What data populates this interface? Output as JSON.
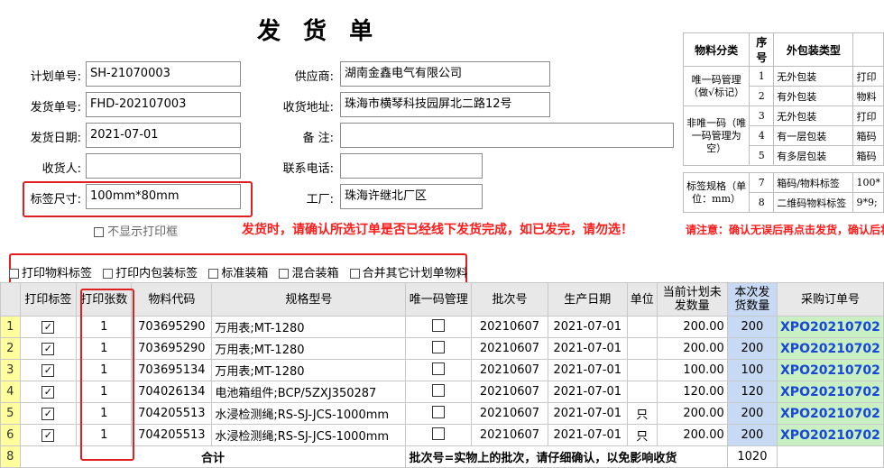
{
  "form": {
    "title": "发 货 单",
    "fields": {
      "plan_no": {
        "label": "计划单号:",
        "value": "SH-21070003"
      },
      "ship_no": {
        "label": "发货单号:",
        "value": "FHD-202107003"
      },
      "ship_date": {
        "label": "发货日期:",
        "value": "2021-07-01"
      },
      "receiver": {
        "label": "收货人:",
        "value": ""
      },
      "label_size": {
        "label": "标签尺寸:",
        "value": "100mm*80mm"
      },
      "supplier": {
        "label": "供应商:",
        "value": "湖南金鑫电气有限公司"
      },
      "ship_address": {
        "label": "收货地址:",
        "value": "珠海市横琴科技园屏北二路12号"
      },
      "remark": {
        "label": "备  注:",
        "value": ""
      },
      "phone": {
        "label": "联系电话:",
        "value": ""
      },
      "factory": {
        "label": "工厂:",
        "value": "珠海许继北厂区"
      }
    },
    "no_print_box_label": "不显示打印框",
    "warning_main": "发货时，请确认所选订单是否已经线下发货完成，如已发完，请勿选！",
    "warning_side": "请注意：确认无误后再点击发货，确认后将"
  },
  "options": [
    "打印物料标签",
    "打印内包装标签",
    "标准装箱",
    "混合装箱",
    "合并其它计划单物料"
  ],
  "packaging": {
    "headers": [
      "物料分类",
      "序号",
      "外包装类型",
      ""
    ],
    "groups": [
      {
        "category": "唯一码管理（做√标记）",
        "rows": [
          {
            "no": "1",
            "type": "无外包装",
            "extra": "打印"
          },
          {
            "no": "2",
            "type": "有外包装",
            "extra": "物料"
          }
        ]
      },
      {
        "category": "非唯一码（唯一码管理为空）",
        "rows": [
          {
            "no": "3",
            "type": "无外包装",
            "extra": "打印"
          },
          {
            "no": "4",
            "type": "有一层包装",
            "extra": "箱码"
          },
          {
            "no": "5",
            "type": "有多层包装",
            "extra": "箱码"
          }
        ]
      },
      {
        "category": "标签规格（单位：mm）",
        "rows": [
          {
            "no": "7",
            "type": "箱码/物料标签",
            "extra": "100*"
          },
          {
            "no": "8",
            "type": "二维码物料标签",
            "extra": "9*9;"
          }
        ]
      }
    ]
  },
  "grid": {
    "headers": [
      "",
      "打印标签",
      "打印张数",
      "物料代码",
      "规格型号",
      "唯一码管理",
      "批次号",
      "生产日期",
      "单位",
      "当前计划未发数量",
      "本次发货数量",
      "采购订单号"
    ],
    "rows": [
      {
        "n": "1",
        "copies": "1",
        "code": "703695290",
        "spec": "万用表;MT-1280",
        "batch": "20210607",
        "date": "2021-07-01",
        "unit": "",
        "remain": "200.00",
        "qty": "200",
        "po": "XPO20210702"
      },
      {
        "n": "2",
        "copies": "1",
        "code": "703695290",
        "spec": "万用表;MT-1280",
        "batch": "20210607",
        "date": "2021-07-01",
        "unit": "",
        "remain": "200.00",
        "qty": "200",
        "po": "XPO20210702"
      },
      {
        "n": "3",
        "copies": "1",
        "code": "703695134",
        "spec": "万用表;MT-1280",
        "batch": "20210607",
        "date": "2021-07-01",
        "unit": "",
        "remain": "100.00",
        "qty": "100",
        "po": "XPO20210702"
      },
      {
        "n": "4",
        "copies": "1",
        "code": "704026134",
        "spec": "电池箱组件;BCP/5ZXJ350287",
        "batch": "20210607",
        "date": "2021-07-01",
        "unit": "",
        "remain": "120.00",
        "qty": "120",
        "po": "XPO20210702"
      },
      {
        "n": "5",
        "copies": "1",
        "code": "704205513",
        "spec": "水浸检测绳;RS-SJ-JCS-1000mm",
        "batch": "20210607",
        "date": "2021-07-01",
        "unit": "只",
        "remain": "200.00",
        "qty": "200",
        "po": "XPO20210702"
      },
      {
        "n": "6",
        "copies": "1",
        "code": "704205513",
        "spec": "水浸检测绳;RS-SJ-JCS-1000mm",
        "batch": "20210607",
        "date": "2021-07-01",
        "unit": "只",
        "remain": "200.00",
        "qty": "200",
        "po": "XPO20210702"
      }
    ],
    "footer": {
      "n": "8",
      "label": "合计",
      "note": "批次号=实物上的批次，请仔细确认，以免影响收货",
      "total": "1020"
    }
  }
}
